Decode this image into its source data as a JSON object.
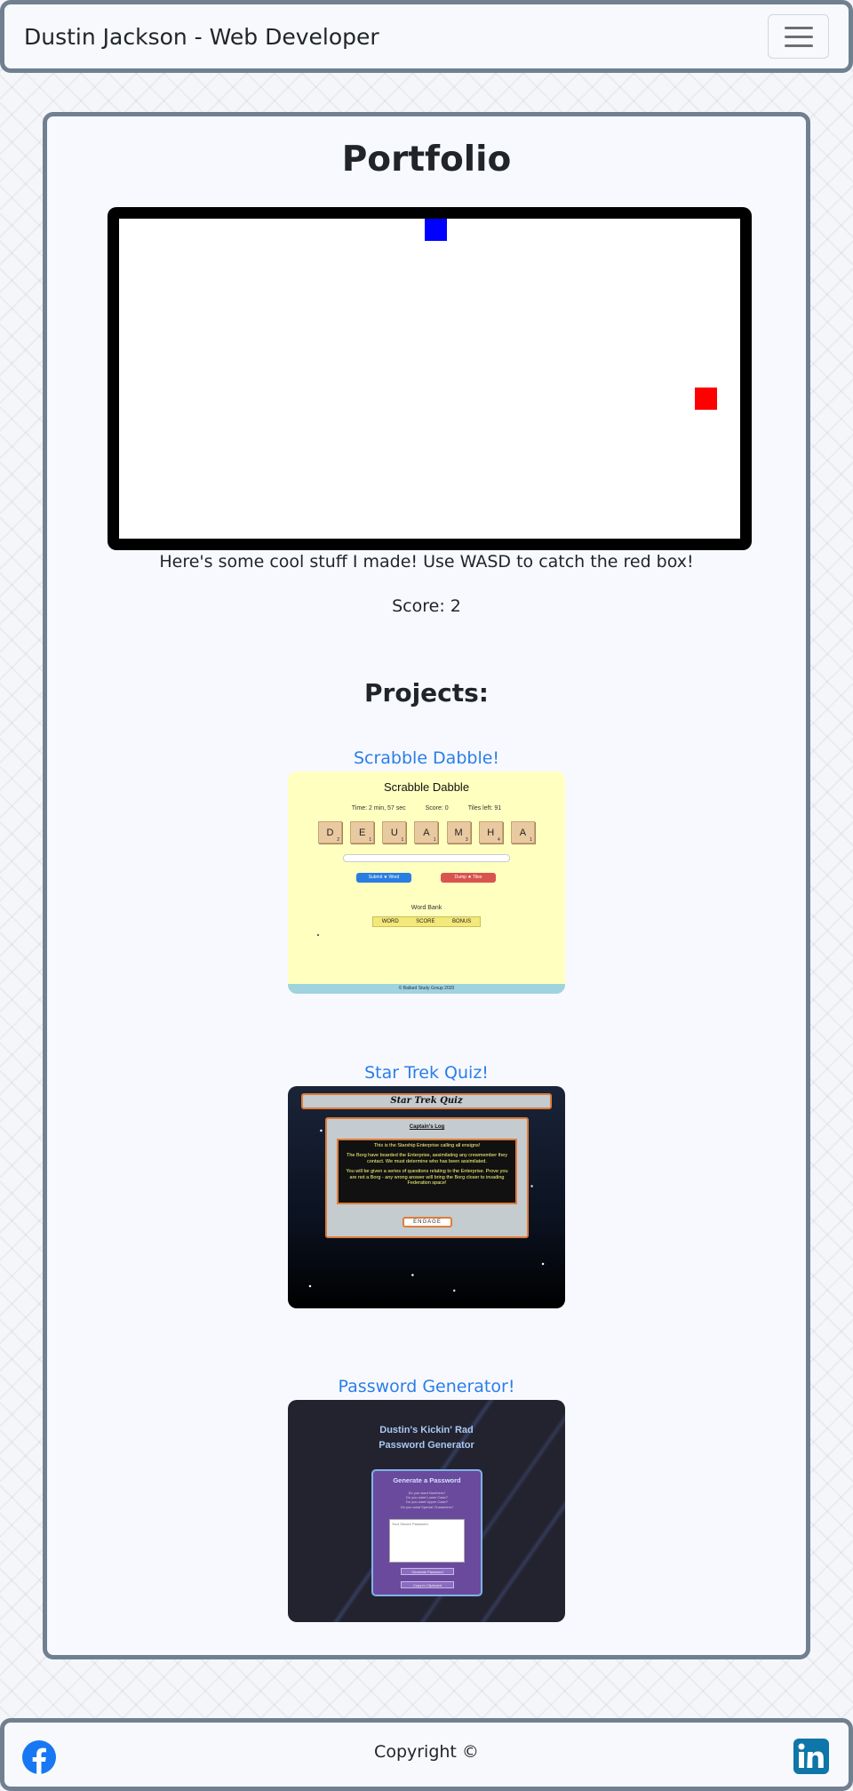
{
  "navbar": {
    "brand": "Dustin Jackson - Web Developer",
    "toggler_icon": "hamburger-icon"
  },
  "main": {
    "title": "Portfolio",
    "game": {
      "caption": "Here's some cool stuff I made! Use WASD to catch the red box!",
      "score_label": "Score:",
      "score_value": "2",
      "player_color": "#0000ff",
      "target_color": "#ff0000"
    },
    "projects_title": "Projects:",
    "projects": [
      {
        "link": "Scrabble Dabble!",
        "thumb": {
          "title": "Scrabble Dabble",
          "time": "Time: 2 min, 57 sec",
          "score": "Score: 0",
          "tiles_left": "Tiles left: 91",
          "tiles": [
            {
              "letter": "D",
              "pts": "2"
            },
            {
              "letter": "E",
              "pts": "1"
            },
            {
              "letter": "U",
              "pts": "1"
            },
            {
              "letter": "A",
              "pts": "1"
            },
            {
              "letter": "M",
              "pts": "3"
            },
            {
              "letter": "H",
              "pts": "4"
            },
            {
              "letter": "A",
              "pts": "1"
            }
          ],
          "submit": "Submit ★ Word",
          "dump": "Dump ★ Tiles",
          "word_bank": "Word Bank",
          "wb_cols": [
            "WORD",
            "SCORE",
            "BONUS"
          ],
          "footer": "© Ballard Study Group 2020"
        }
      },
      {
        "link": "Star Trek Quiz!",
        "thumb": {
          "title": "Star Trek Quiz",
          "log_title": "Captain's Log",
          "p1": "This is the Starship Enterprise calling all ensigns!",
          "p2": "The Borg have boarded the Enterprise, assimilating any crewmember they contact. We must determine who has been assimilated.",
          "p3": "You will be given a series of questions relating to the Enterprise. Prove you are not a Borg - any wrong answer will bring the Borg closer to invading Federation space!",
          "engage": "ENGAGE"
        }
      },
      {
        "link": "Password Generator!",
        "thumb": {
          "title_line1": "Dustin's Kickin' Rad",
          "title_line2": "Password Generator",
          "card_title": "Generate a Password",
          "opt1": "Do you want Numbers?",
          "opt2": "Do you want Lower Case?",
          "opt3": "Do you want Upper Case?",
          "opt4": "Do you want Special Characters?",
          "placeholder": "Your Secure Password",
          "btn1": "Generate Password",
          "btn2": "Copy to Clipboard"
        }
      }
    ]
  },
  "footer": {
    "copyright": "Copyright ©",
    "facebook_icon": "facebook-icon",
    "linkedin_icon": "linkedin-icon",
    "facebook_color": "#1877f2",
    "linkedin_color": "#0e76a8"
  }
}
